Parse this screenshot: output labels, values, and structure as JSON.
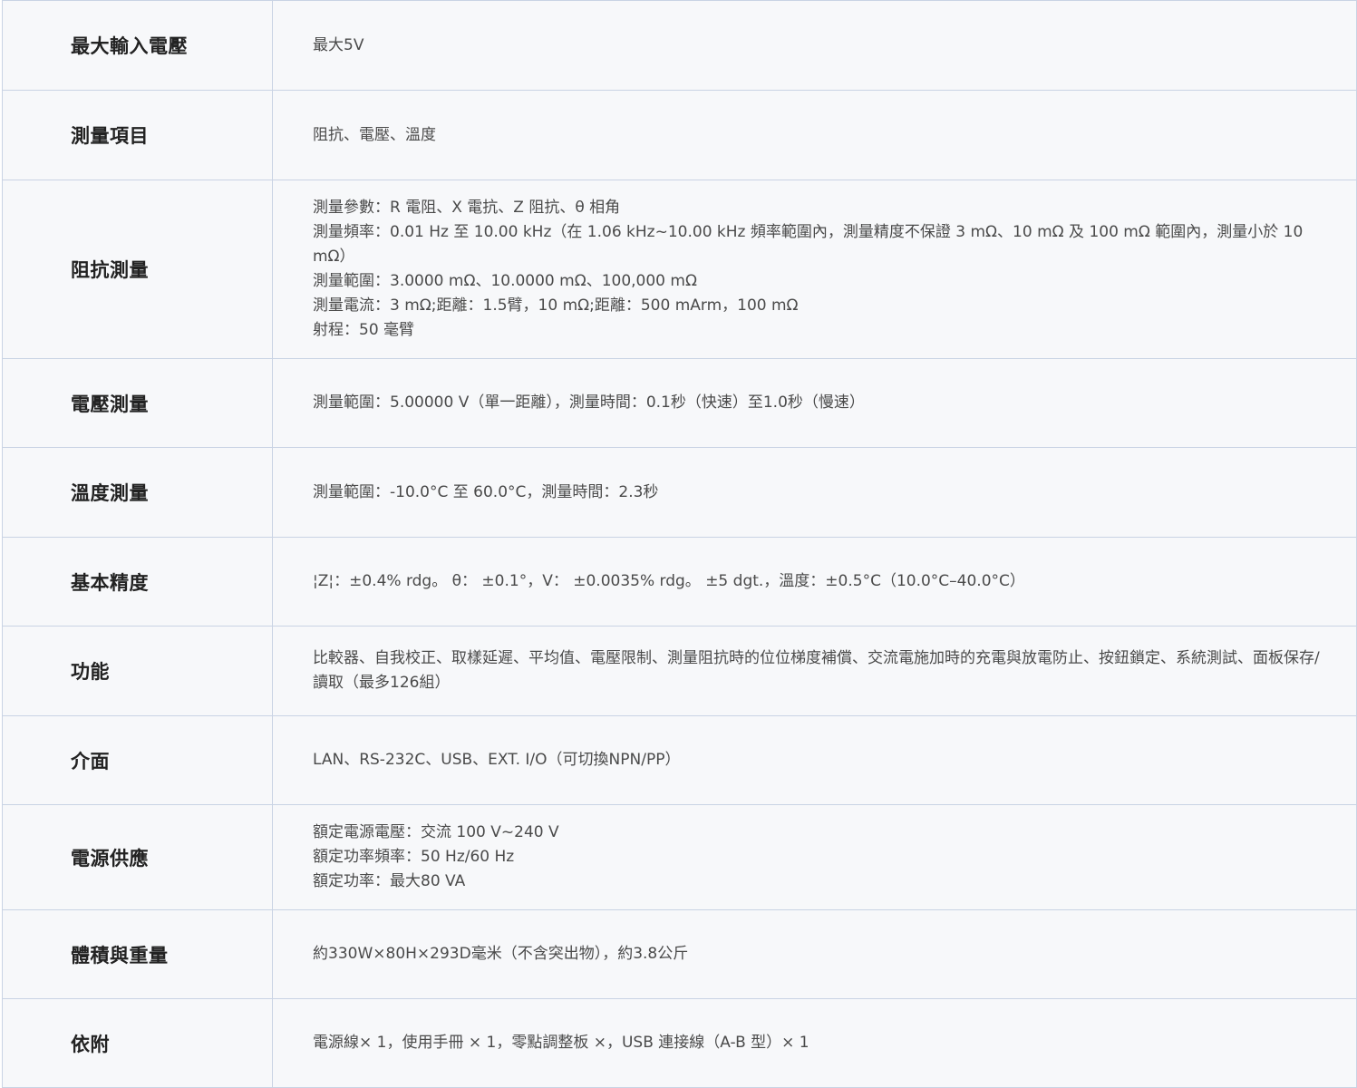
{
  "spec_rows": [
    {
      "label": "最大輸入電壓",
      "lines": [
        "最大5V"
      ]
    },
    {
      "label": "測量項目",
      "lines": [
        "阻抗、電壓、溫度"
      ]
    },
    {
      "label": "阻抗測量",
      "lines": [
        "測量參數：R 電阻、X 電抗、Z 阻抗、θ 相角",
        "測量頻率：0.01 Hz 至 10.00 kHz（在 1.06 kHz~10.00 kHz 頻率範圍內，測量精度不保證 3 mΩ、10 mΩ 及 100 mΩ 範圍內，測量小於 10 mΩ）",
        "測量範圍：3.0000 mΩ、10.0000 mΩ、100,000 mΩ",
        "測量電流：3 mΩ;距離：1.5臂，10 mΩ;距離：500 mArm，100 mΩ",
        "射程：50 毫臂"
      ]
    },
    {
      "label": "電壓測量",
      "lines": [
        "測量範圍：5.00000 V（單一距離），測量時間：0.1秒（快速）至1.0秒（慢速）"
      ]
    },
    {
      "label": "溫度測量",
      "lines": [
        "測量範圍：-10.0°C 至 60.0°C，測量時間：2.3秒"
      ]
    },
    {
      "label": "基本精度",
      "lines": [
        "¦Z¦：±0.4% rdg。 θ： ±0.1°，V： ±0.0035% rdg。 ±5 dgt.，溫度：±0.5°C（10.0°C–40.0°C）"
      ]
    },
    {
      "label": "功能",
      "lines": [
        "比較器、自我校正、取樣延遲、平均值、電壓限制、測量阻抗時的位位梯度補償、交流電施加時的充電與放電防止、按鈕鎖定、系統測試、面板保存/讀取（最多126組）"
      ]
    },
    {
      "label": "介面",
      "lines": [
        "LAN、RS-232C、USB、EXT. I/O（可切換NPN/PP）"
      ]
    },
    {
      "label": "電源供應",
      "lines": [
        "額定電源電壓：交流 100 V~240 V",
        "額定功率頻率：50 Hz/60 Hz",
        "額定功率：最大80 VA"
      ]
    },
    {
      "label": "體積與重量",
      "lines": [
        "約330W×80H×293D毫米（不含突出物），約3.8公斤"
      ]
    },
    {
      "label": "依附",
      "lines": [
        "電源線× 1，使用手冊 × 1，零點調整板 ×，USB 連接線（A-B 型）× 1"
      ]
    }
  ]
}
